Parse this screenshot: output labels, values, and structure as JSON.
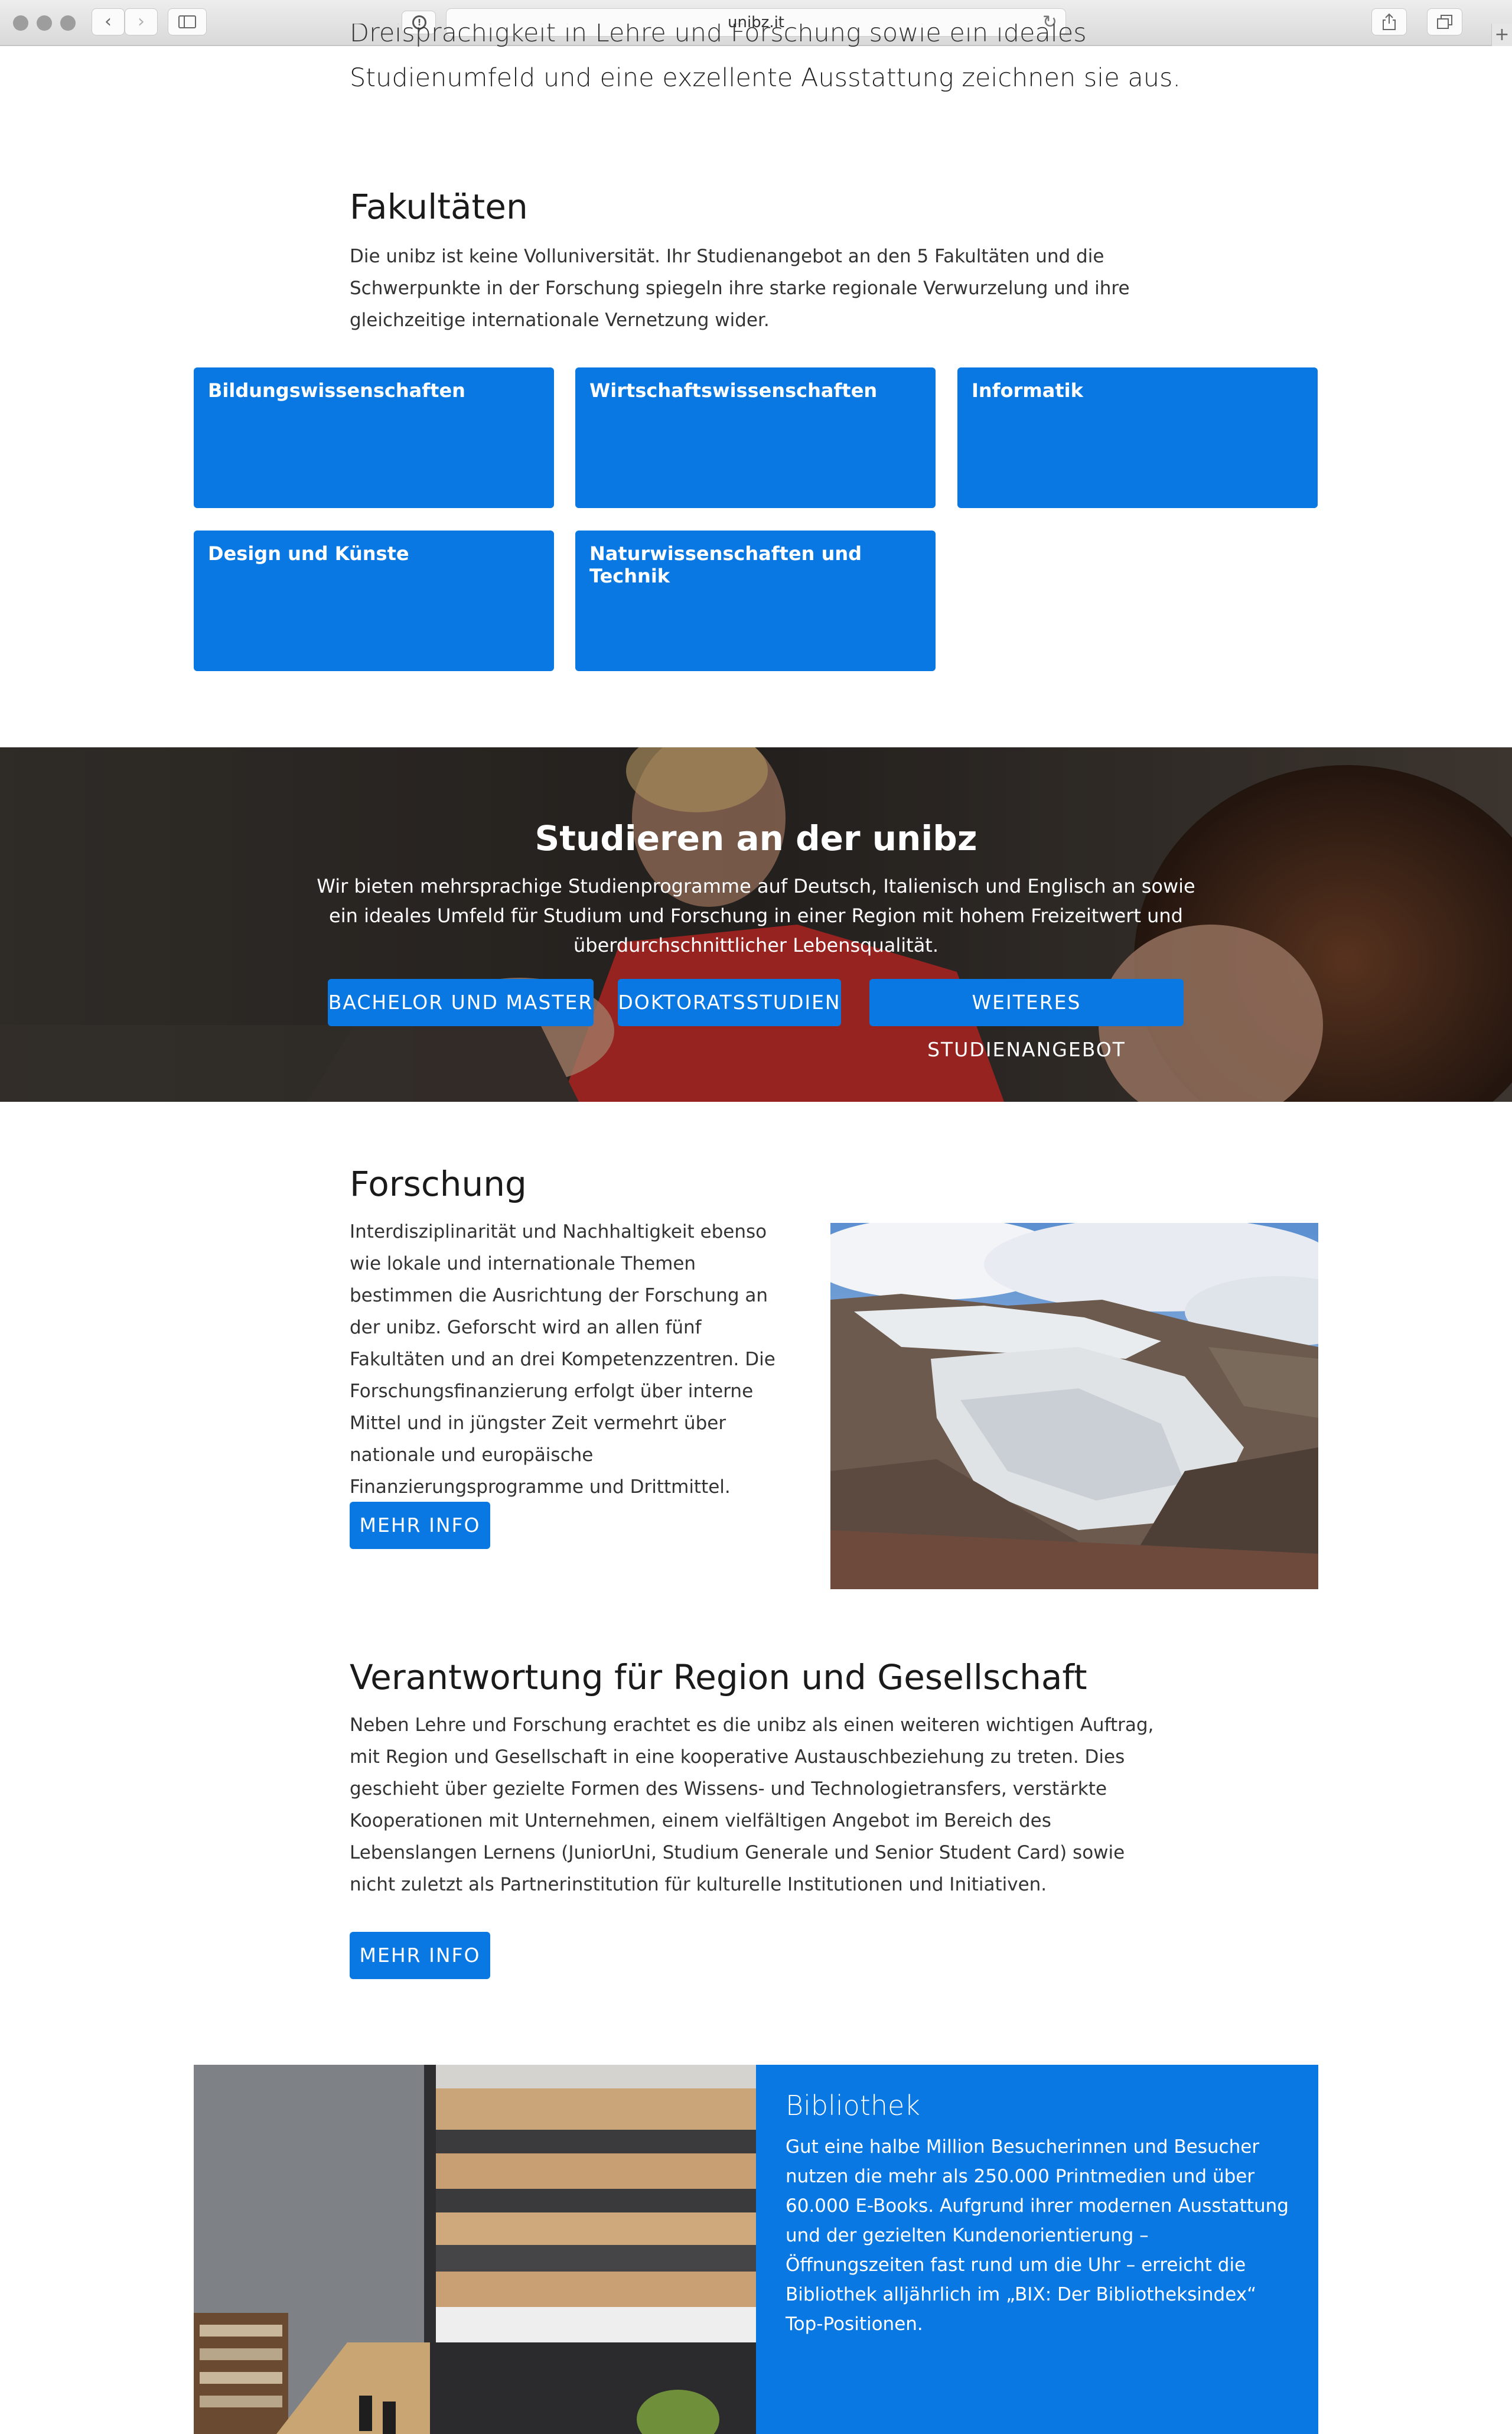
{
  "browser": {
    "url": "unibz.it"
  },
  "intro": {
    "cut_line": "Dreisprachigkeit in Lehre und Forschung sowie ein ideales",
    "last_line": "Studienumfeld und eine exzellente Ausstattung zeichnen sie aus."
  },
  "faculties": {
    "heading": "Fakultäten",
    "text": "Die unibz ist keine Volluniversität. Ihr Studienangebot an den 5 Fakultäten und die Schwerpunkte in der Forschung spiegeln ihre starke regionale Verwurzelung und ihre gleichzeitige internationale Vernetzung wider.",
    "items": [
      {
        "label": "Bildungswissenschaften"
      },
      {
        "label": "Wirtschaftswissenschaften"
      },
      {
        "label": "Informatik"
      },
      {
        "label": "Design und Künste"
      },
      {
        "label": "Naturwissenschaften und Technik"
      }
    ]
  },
  "study": {
    "heading": "Studieren an der unibz",
    "text": "Wir bieten mehrsprachige Studienprogramme auf Deutsch, Italienisch und Englisch an sowie ein ideales Umfeld für Studium und Forschung in einer Region mit hohem Freizeitwert und überdurchschnittlicher Lebensqualität.",
    "buttons": [
      {
        "label": "BACHELOR UND MASTER"
      },
      {
        "label": "DOKTORATSSTUDIEN"
      },
      {
        "label": "WEITERES STUDIENANGEBOT"
      }
    ]
  },
  "research": {
    "heading": "Forschung",
    "text": "Interdisziplinarität und Nachhaltigkeit ebenso wie lokale und internationale Themen bestimmen die Ausrichtung der Forschung an der unibz. Geforscht wird an allen fünf Fakultäten und an drei Kompetenzzentren. Die Forschungsfinanzierung erfolgt über interne Mittel und in jüngster Zeit vermehrt über nationale und europäische Finanzierungsprogramme und Drittmittel.",
    "button": "MEHR INFO"
  },
  "responsibility": {
    "heading": "Verantwortung für Region und Gesellschaft",
    "text": "Neben Lehre und Forschung erachtet es die unibz als einen weiteren wichtigen Auftrag, mit Region und Gesellschaft in eine kooperative Austauschbeziehung zu treten. Dies geschieht über gezielte Formen des Wissens- und Technologietransfers, verstärkte Kooperationen mit Unternehmen, einem vielfältigen Angebot im Bereich des Lebenslangen Lernens (JuniorUni, Studium Generale und Senior Student Card) sowie nicht zuletzt als Partnerinstitution für kulturelle Institutionen und Initiativen.",
    "button": "MEHR INFO"
  },
  "library": {
    "heading": "Bibliothek",
    "text": "Gut eine halbe Million Besucherinnen und Besucher nutzen die mehr als 250.000 Printmedien und über 60.000 E-Books. Aufgrund ihrer modernen Ausstattung und der gezielten Kundenorientierung – Öffnungszeiten fast rund um die Uhr – erreicht die Bibliothek alljährlich im „BIX: Der Bibliotheksindex“ Top-Positionen."
  },
  "colors": {
    "accent": "#0a78e2",
    "text": "#1a1a1a",
    "banner_dark": "#2e2a27"
  },
  "icons": [
    "back-arrow-icon",
    "forward-arrow-icon",
    "sidebar-icon",
    "privacy-icon",
    "reload-icon",
    "share-icon",
    "tabs-icon",
    "new-tab-icon"
  ]
}
